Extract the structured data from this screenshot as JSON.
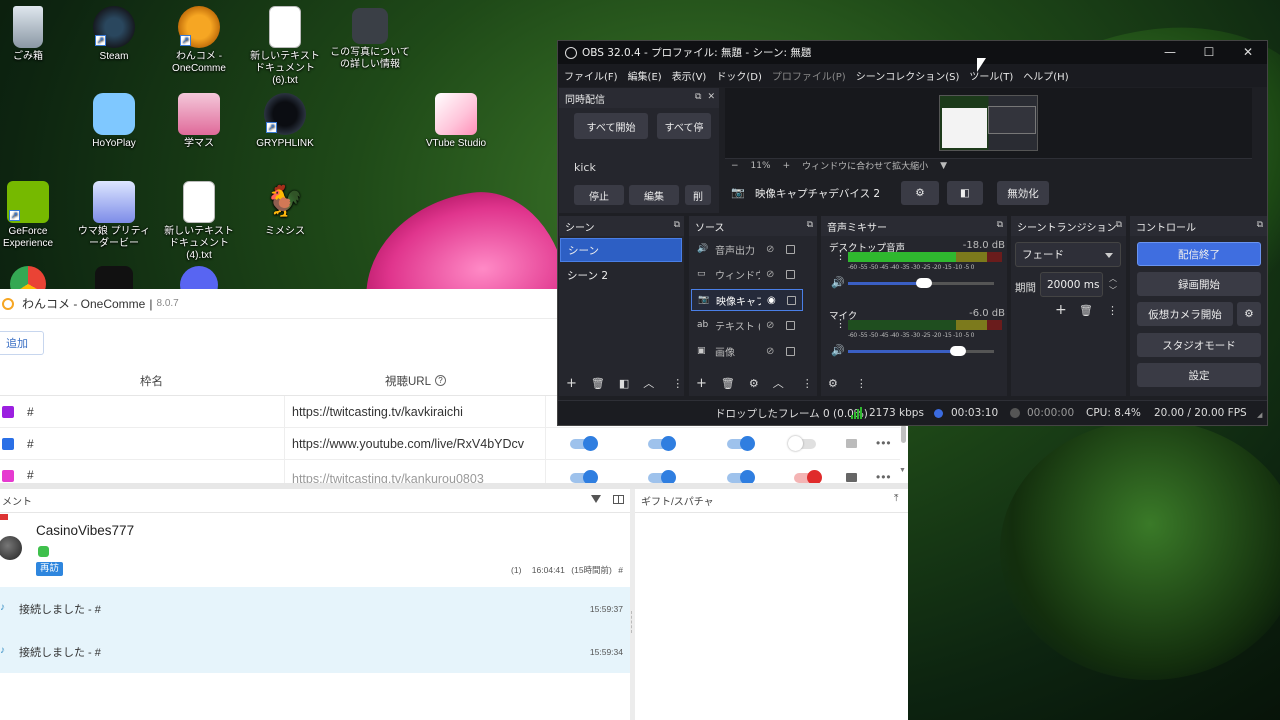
{
  "desktop": {
    "icons": [
      {
        "label": "ごみ箱",
        "icon": "recycle-bin-icon"
      },
      {
        "label": "Steam",
        "icon": "steam-icon"
      },
      {
        "label": "わんコメ - OneComme",
        "icon": "onecomme-icon"
      },
      {
        "label": "新しいテキスト ドキュメント (6).txt",
        "icon": "text-file-icon"
      },
      {
        "label": "この写真についての詳しい情報",
        "icon": "photo-info-icon"
      },
      {
        "label": "HoYoPlay",
        "icon": "hoyoplay-icon"
      },
      {
        "label": "学マス",
        "icon": "gakumas-icon"
      },
      {
        "label": "GRYPHLINK",
        "icon": "gryphlink-icon"
      },
      {
        "label": "VTube Studio",
        "icon": "vtube-studio-icon"
      },
      {
        "label": "GeForce Experience",
        "icon": "geforce-icon"
      },
      {
        "label": "ウマ娘 プリティーダービー",
        "icon": "umamusume-icon"
      },
      {
        "label": "新しいテキスト ドキュメント (4).txt",
        "icon": "text-file-icon"
      },
      {
        "label": "ミメシス",
        "icon": "mimesis-icon"
      }
    ]
  },
  "onecomme": {
    "title": "わんコメ - OneComme",
    "separator": "|",
    "version": "8.0.7",
    "add_label": "追加",
    "columns": {
      "name": "枠名",
      "url": "視聴URL"
    },
    "channels": [
      {
        "color": "#9b1fe0",
        "name": "#",
        "url": "https://twitcasting.tv/kavkiraichi"
      },
      {
        "color": "#2a6fe6",
        "name": "#",
        "url": "https://www.youtube.com/live/RxV4bYDcv"
      },
      {
        "color": "#e63ad0",
        "name": "#",
        "url": "https://twitcasting.tv/kankurou0803"
      }
    ],
    "comment_panel_title": "メント",
    "gift_panel_title": "ギフト/スパチャ",
    "comments": [
      {
        "user": "CasinoVibes777",
        "badge": "再訪",
        "count": "(1)",
        "time": "16:04:41",
        "ago": "(15時間前)",
        "hash": "#"
      }
    ],
    "system_messages": [
      {
        "text": "接続しました - #",
        "time": "15:59:37"
      },
      {
        "text": "接続しました - #",
        "time": "15:59:34"
      }
    ]
  },
  "obs": {
    "title": "OBS 32.0.4 - プロファイル: 無題 - シーン: 無題",
    "menu": [
      "ファイル(F)",
      "編集(E)",
      "表示(V)",
      "ドック(D)",
      "プロファイル(P)",
      "シーンコレクション(S)",
      "ツール(T)",
      "ヘルプ(H)"
    ],
    "multistream": {
      "title": "同時配信",
      "start_all": "すべて開始",
      "stop_all": "すべて停",
      "platform": "kick",
      "stop": "停止",
      "edit": "編集",
      "extra": "削"
    },
    "zoom": {
      "minus": "−",
      "percent": "11%",
      "plus": "+",
      "fit": "ウィンドウに合わせて拡大縮小"
    },
    "active_source": {
      "name": "映像キャプチャデバイス 2",
      "disable": "無効化"
    },
    "scenes": {
      "title": "シーン",
      "items": [
        "シーン",
        "シーン 2"
      ],
      "selected": 0
    },
    "sources": {
      "title": "ソース",
      "items": [
        {
          "name": "音声出力",
          "icon": "speaker"
        },
        {
          "name": "ウィンドウ",
          "icon": "window"
        },
        {
          "name": "映像キャプ",
          "icon": "camera"
        },
        {
          "name": "テキスト (",
          "icon": "text"
        },
        {
          "name": "画像",
          "icon": "image"
        }
      ],
      "selected": 2
    },
    "mixer": {
      "title": "音声ミキサー",
      "channels": [
        {
          "name": "デスクトップ音声",
          "db": "-18.0 dB",
          "level": 0.72,
          "volume": 0.52
        },
        {
          "name": "マイク",
          "db": "-6.0 dB",
          "level": 0.0,
          "volume": 0.75
        }
      ],
      "scale": "-60 -55 -50 -45 -40 -35 -30 -25 -20 -15 -10 -5 0"
    },
    "transitions": {
      "title": "シーントランジション",
      "type": "フェード",
      "duration_label": "期間",
      "duration": "20000 ms"
    },
    "controls": {
      "title": "コントロール",
      "stop_stream": "配信終了",
      "start_record": "録画開始",
      "virtual_cam": "仮想カメラ開始",
      "studio_mode": "スタジオモード",
      "settings": "設定"
    },
    "status": {
      "dropped": "ドロップしたフレーム 0 (0.0%)",
      "bitrate": "2173 kbps",
      "stream_time": "00:03:10",
      "record_time": "00:00:00",
      "cpu": "CPU: 8.4%",
      "fps": "20.00 / 20.00 FPS"
    }
  }
}
